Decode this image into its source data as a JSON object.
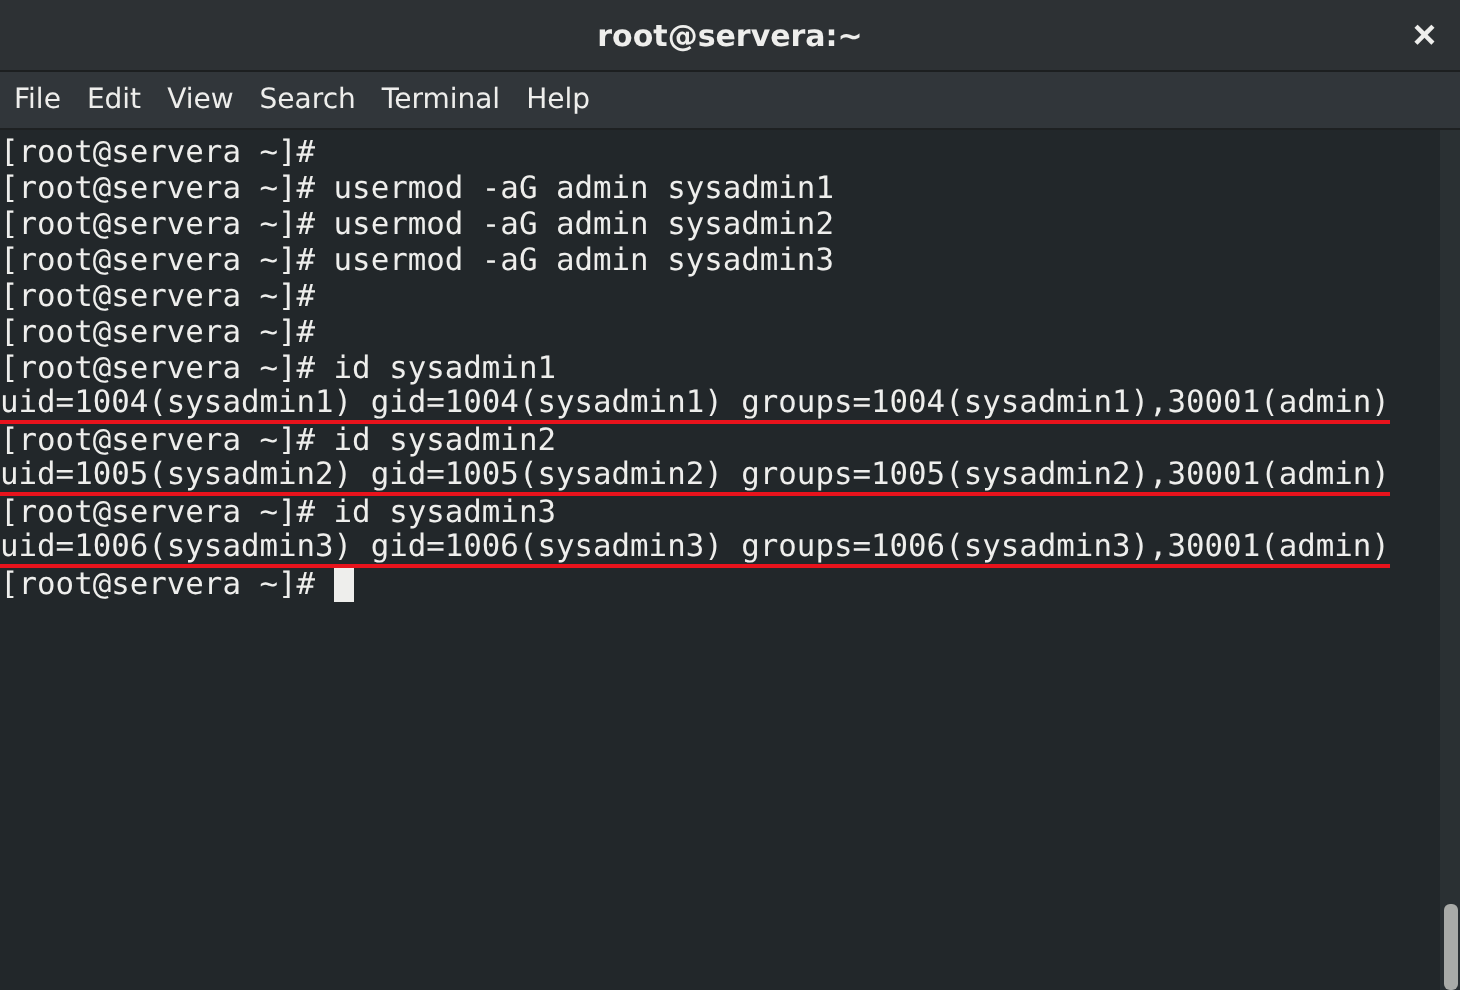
{
  "window": {
    "title": "root@servera:~",
    "close": "×"
  },
  "menu": [
    "File",
    "Edit",
    "View",
    "Search",
    "Terminal",
    "Help"
  ],
  "terminal": {
    "lines": [
      {
        "text": "[root@servera ~]#",
        "underlined": false,
        "cursor": false
      },
      {
        "text": "[root@servera ~]# usermod -aG admin sysadmin1",
        "underlined": false,
        "cursor": false
      },
      {
        "text": "[root@servera ~]# usermod -aG admin sysadmin2",
        "underlined": false,
        "cursor": false
      },
      {
        "text": "[root@servera ~]# usermod -aG admin sysadmin3",
        "underlined": false,
        "cursor": false
      },
      {
        "text": "[root@servera ~]#",
        "underlined": false,
        "cursor": false
      },
      {
        "text": "[root@servera ~]#",
        "underlined": false,
        "cursor": false
      },
      {
        "text": "[root@servera ~]# id sysadmin1",
        "underlined": false,
        "cursor": false
      },
      {
        "text": "uid=1004(sysadmin1) gid=1004(sysadmin1) groups=1004(sysadmin1),30001(admin)",
        "underlined": true,
        "cursor": false
      },
      {
        "text": "[root@servera ~]# id sysadmin2",
        "underlined": false,
        "cursor": false
      },
      {
        "text": "uid=1005(sysadmin2) gid=1005(sysadmin2) groups=1005(sysadmin2),30001(admin)",
        "underlined": true,
        "cursor": false
      },
      {
        "text": "[root@servera ~]# id sysadmin3",
        "underlined": false,
        "cursor": false
      },
      {
        "text": "uid=1006(sysadmin3) gid=1006(sysadmin3) groups=1006(sysadmin3),30001(admin)",
        "underlined": true,
        "cursor": false
      },
      {
        "text": "[root@servera ~]#",
        "underlined": false,
        "cursor": true
      }
    ]
  }
}
